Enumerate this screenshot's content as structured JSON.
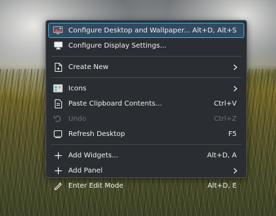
{
  "menu": {
    "items": [
      {
        "label": "Configure Desktop and Wallpaper...",
        "shortcut": "Alt+D, Alt+S",
        "icon": "desktop-wallpaper-icon"
      },
      {
        "label": "Configure Display Settings...",
        "shortcut": "",
        "icon": "display-icon"
      },
      {
        "label": "Create New",
        "shortcut": "",
        "icon": "new-document-icon",
        "submenu": true
      },
      {
        "label": "Icons",
        "shortcut": "",
        "icon": "icons-view-icon",
        "submenu": true
      },
      {
        "label": "Paste Clipboard Contents...",
        "shortcut": "Ctrl+V",
        "icon": "paste-icon"
      },
      {
        "label": "Undo",
        "shortcut": "Ctrl+Z",
        "icon": "undo-icon",
        "disabled": true
      },
      {
        "label": "Refresh Desktop",
        "shortcut": "F5",
        "icon": "refresh-icon"
      },
      {
        "label": "Add Widgets...",
        "shortcut": "Alt+D, A",
        "icon": "plus-icon"
      },
      {
        "label": "Add Panel",
        "shortcut": "",
        "icon": "plus-icon",
        "submenu": true
      },
      {
        "label": "Enter Edit Mode",
        "shortcut": "Alt+D, E",
        "icon": "edit-icon"
      }
    ]
  },
  "colors": {
    "menu_bg": "#2a2e32",
    "highlight_border": "#3daee9",
    "highlight_bg": "#324a5f",
    "text": "#eff0f1",
    "disabled_text": "#6e7276"
  }
}
